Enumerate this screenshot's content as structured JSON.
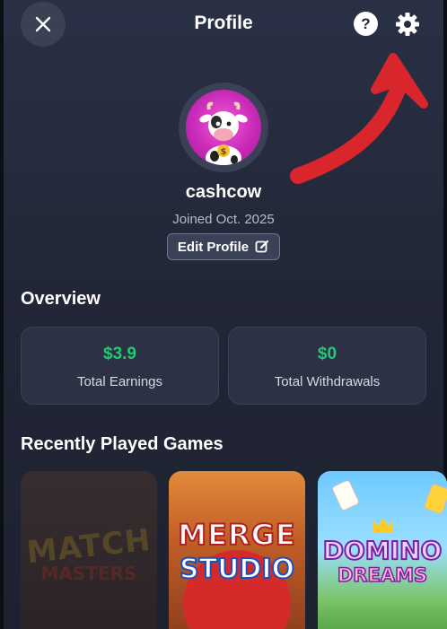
{
  "header": {
    "title": "Profile",
    "help_symbol": "?",
    "icons": {
      "close": "close-icon",
      "help": "help-icon",
      "settings": "gear-icon"
    }
  },
  "annotation": {
    "arrow_color": "#d9262c"
  },
  "profile": {
    "username": "cashcow",
    "joined": "Joined Oct. 2025",
    "edit_label": "Edit Profile"
  },
  "overview": {
    "title": "Overview",
    "cards": [
      {
        "value": "$3.9",
        "label": "Total Earnings"
      },
      {
        "value": "$0",
        "label": "Total Withdrawals"
      }
    ]
  },
  "games": {
    "title": "Recently Played Games",
    "items": [
      {
        "logo_line1": "MATCH",
        "logo_line2": "MASTERS"
      },
      {
        "logo_line1": "MERGE",
        "logo_line2": "STUDIO"
      },
      {
        "logo_line1": "DOMINO",
        "logo_line2": "DREAMS"
      }
    ]
  },
  "colors": {
    "accent_green": "#23c876",
    "background": "#222737",
    "card": "#2c3244"
  }
}
